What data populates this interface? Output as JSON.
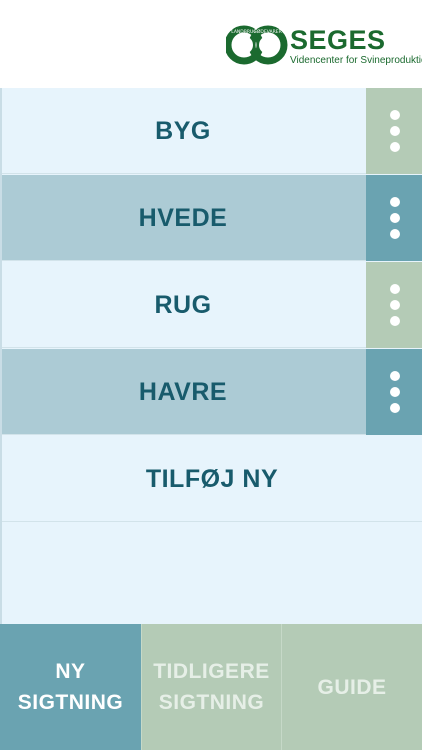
{
  "header": {
    "logo": {
      "title": "SEGES",
      "subtitle": "Videncenter for Svineproduktion",
      "ring_text_left": "LANDBRUG",
      "ring_text_right": "FØDEVARER",
      "color": "#1b6a2f"
    }
  },
  "crops": [
    {
      "label": "BYG",
      "style": "light",
      "menu_icon": "more-vertical-icon"
    },
    {
      "label": "HVEDE",
      "style": "dark",
      "menu_icon": "more-vertical-icon"
    },
    {
      "label": "RUG",
      "style": "light",
      "menu_icon": "more-vertical-icon"
    },
    {
      "label": "HAVRE",
      "style": "dark",
      "menu_icon": "more-vertical-icon"
    }
  ],
  "add_new": {
    "label": "TILFØJ NY"
  },
  "tabs": [
    {
      "label": "NY\nSIGTNING",
      "active": true
    },
    {
      "label": "TIDLIGERE\nSIGTNING",
      "active": false
    },
    {
      "label": "GUIDE",
      "active": false
    }
  ],
  "colors": {
    "list_bg": "#e7f4fc",
    "row_dark": "#accbd5",
    "text": "#185b6c",
    "menu_green": "#b4cbb6",
    "menu_teal": "#6aa3b1",
    "tab_active": "#6aa3b1",
    "tab_inactive": "#b4cbb6"
  }
}
